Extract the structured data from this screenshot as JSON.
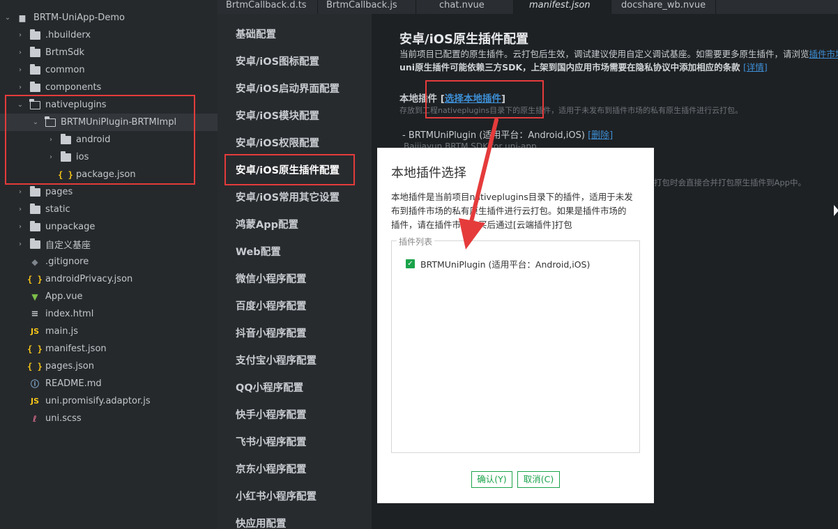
{
  "tree": {
    "root_label": "BRTM-UniApp-Demo",
    "items": [
      {
        "label": ".hbuilderx",
        "icon": "folder-icon"
      },
      {
        "label": "BrtmSdk",
        "icon": "folder-icon"
      },
      {
        "label": "common",
        "icon": "folder-icon"
      },
      {
        "label": "components",
        "icon": "folder-icon"
      },
      {
        "label": "nativeplugins",
        "icon": "folder-open-icon"
      },
      {
        "label": "BRTMUniPlugin-BRTMImpl",
        "icon": "folder-open-icon"
      },
      {
        "label": "android",
        "icon": "folder-icon"
      },
      {
        "label": "ios",
        "icon": "folder-icon"
      },
      {
        "label": "package.json",
        "icon": "json-file-icon"
      },
      {
        "label": "pages",
        "icon": "folder-icon"
      },
      {
        "label": "static",
        "icon": "folder-icon"
      },
      {
        "label": "unpackage",
        "icon": "folder-icon"
      },
      {
        "label": "自定义基座",
        "icon": "folder-icon"
      },
      {
        "label": ".gitignore",
        "icon": "gitignore-file-icon"
      },
      {
        "label": "androidPrivacy.json",
        "icon": "json-file-icon"
      },
      {
        "label": "App.vue",
        "icon": "vue-file-icon"
      },
      {
        "label": "index.html",
        "icon": "html-file-icon"
      },
      {
        "label": "main.js",
        "icon": "js-file-icon"
      },
      {
        "label": "manifest.json",
        "icon": "json-file-icon"
      },
      {
        "label": "pages.json",
        "icon": "json-file-icon"
      },
      {
        "label": "README.md",
        "icon": "info-file-icon"
      },
      {
        "label": "uni.promisify.adaptor.js",
        "icon": "js-file-icon"
      },
      {
        "label": "uni.scss",
        "icon": "scss-file-icon"
      }
    ]
  },
  "tabs": [
    "BrtmCallback.d.ts",
    "BrtmCallback.js",
    "chat.nvue",
    "manifest.json",
    "docshare_wb.nvue"
  ],
  "active_tab": "manifest.json",
  "nav": {
    "items": [
      "基础配置",
      "安卓/iOS图标配置",
      "安卓/iOS启动界面配置",
      "安卓/iOS模块配置",
      "安卓/iOS权限配置",
      "安卓/iOS原生插件配置",
      "安卓/iOS常用其它设置",
      "鸿蒙App配置",
      "Web配置",
      "微信小程序配置",
      "百度小程序配置",
      "抖音小程序配置",
      "支付宝小程序配置",
      "QQ小程序配置",
      "快手小程序配置",
      "飞书小程序配置",
      "京东小程序配置",
      "小红书小程序配置",
      "快应用配置"
    ],
    "active": "安卓/iOS原生插件配置"
  },
  "content": {
    "title": "安卓/iOS原生插件配置",
    "desc_line1": "当前项目已配置的原生插件。云打包后生效，调试建议使用自定义调试基座。如需要更多原生插件，请浏览",
    "desc_line1_link": "插件市场",
    "desc_line2": "uni原生插件可能依赖三方SDK，上架到国内应用市场需要在隐私协议中添加相应的条款",
    "desc_line2_link": "[详情]",
    "local_label": "本地插件",
    "local_link": "选择本地插件",
    "local_hint": "存放到工程nativeplugins目录下的原生插件，适用于未发布到插件市场的私有原生插件进行云打包。",
    "plugin_line": "- BRTMUniPlugin (适用平台：Android,iOS)",
    "plugin_delete": "[删除]",
    "plugin_sub": "Baijiayun BRTM SDK for uni-app",
    "right_hint": "打包时会直接合并打包原生插件到App中。"
  },
  "dialog": {
    "title": "本地插件选择",
    "body_lines": [
      "本地插件是当前项目nativeplugins目录下的插件，适用于未发",
      "布到插件市场的私有原生插件进行云打包。如果是插件市场的",
      "插件，请在插件市场购买后通过[云端插件]打包"
    ],
    "list_legend": "插件列表",
    "option_label": "BRTMUniPlugin (适用平台：Android,iOS)",
    "option_checked": true,
    "ok_label": "确认(Y)",
    "cancel_label": "取消(C)"
  },
  "colors": {
    "accent_green": "#1aa34a",
    "annotation_red": "#e53b3b",
    "link_blue": "#3d8fd6"
  }
}
